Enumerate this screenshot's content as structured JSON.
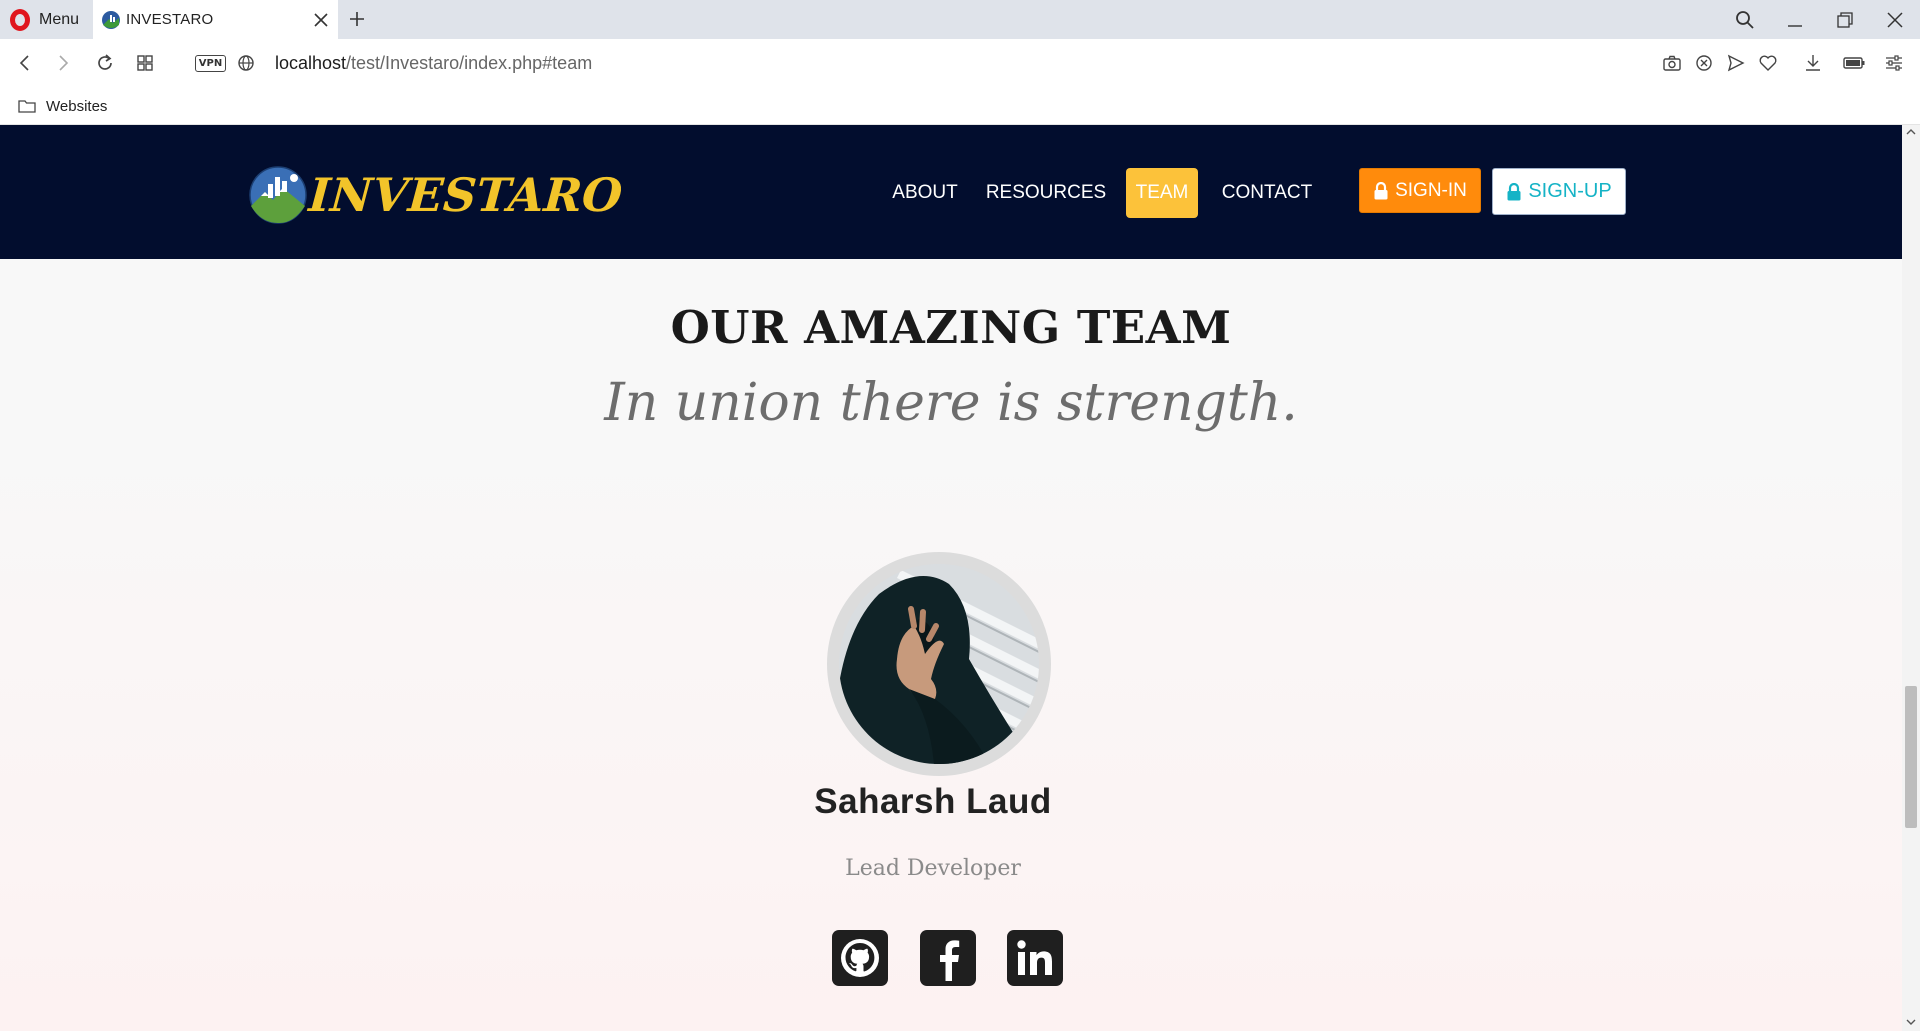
{
  "browser": {
    "menu_label": "Menu",
    "tab_title": "INVESTARO",
    "url_host": "localhost",
    "url_path": "/test/Investaro/index.php#team",
    "vpn_label": "VPN",
    "bookmarks": [
      {
        "label": "Websites"
      }
    ]
  },
  "site": {
    "brand": "INVESTARO",
    "nav": [
      {
        "label": "ABOUT"
      },
      {
        "label": "RESOURCES"
      },
      {
        "label": "TEAM",
        "active": true
      },
      {
        "label": "CONTACT"
      }
    ],
    "signin_label": "SIGN-IN",
    "signup_label": "SIGN-UP"
  },
  "team": {
    "heading": "OUR AMAZING TEAM",
    "tagline": "In union there is strength.",
    "members": [
      {
        "name": "Saharsh Laud",
        "role": "Lead Developer",
        "social": [
          "github-icon",
          "facebook-icon",
          "linkedin-icon"
        ]
      }
    ]
  },
  "colors": {
    "nav_bg": "#020d2e",
    "brand_gold": "#f2c42a",
    "active_tab": "#fcc23a",
    "signin_orange": "#ff8b0c",
    "signup_teal": "#15b3c6"
  }
}
